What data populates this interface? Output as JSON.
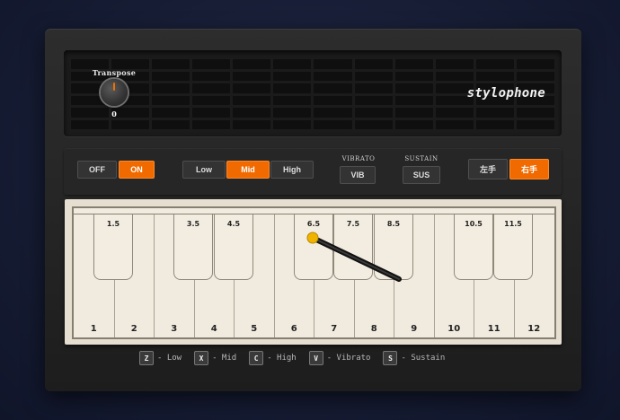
{
  "header": {
    "transpose_label": "Transpose",
    "transpose_value": "0",
    "brand": "stylophone"
  },
  "controls": {
    "power": {
      "off": "OFF",
      "on": "ON",
      "selected": "ON"
    },
    "octave": {
      "low": "Low",
      "mid": "Mid",
      "high": "High",
      "selected": "Mid"
    },
    "vibrato": {
      "label": "VIBRATO",
      "button": "VIB"
    },
    "sustain": {
      "label": "SUSTAIN",
      "button": "SUS"
    },
    "hand": {
      "left": "左手",
      "right": "右手",
      "selected": "右手"
    }
  },
  "keyboard": {
    "white_keys": [
      "1",
      "2",
      "3",
      "4",
      "5",
      "6",
      "7",
      "8",
      "9",
      "10",
      "11",
      "12"
    ],
    "black_keys": [
      "1.5",
      "3.5",
      "4.5",
      "6.5",
      "7.5",
      "8.5",
      "10.5",
      "11.5"
    ]
  },
  "shortcuts": [
    {
      "key": "Z",
      "desc": "- Low"
    },
    {
      "key": "X",
      "desc": "- Mid"
    },
    {
      "key": "C",
      "desc": "- High"
    },
    {
      "key": "V",
      "desc": "- Vibrato"
    },
    {
      "key": "S",
      "desc": "- Sustain"
    }
  ],
  "colors": {
    "accent": "#f06a00",
    "stylus_tip": "#f0b400"
  }
}
